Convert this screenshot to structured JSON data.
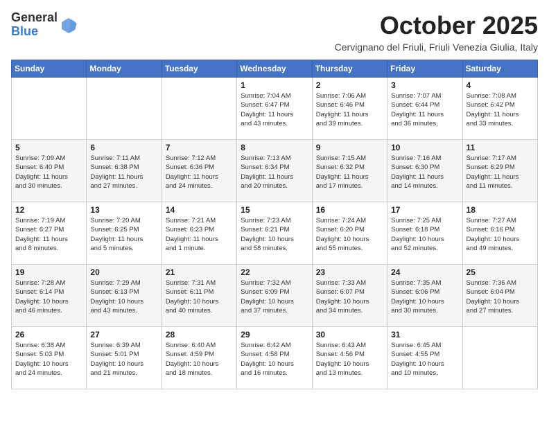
{
  "logo": {
    "general": "General",
    "blue": "Blue"
  },
  "header": {
    "title": "October 2025",
    "subtitle": "Cervignano del Friuli, Friuli Venezia Giulia, Italy"
  },
  "days_of_week": [
    "Sunday",
    "Monday",
    "Tuesday",
    "Wednesday",
    "Thursday",
    "Friday",
    "Saturday"
  ],
  "weeks": [
    [
      {
        "day": "",
        "detail": ""
      },
      {
        "day": "",
        "detail": ""
      },
      {
        "day": "",
        "detail": ""
      },
      {
        "day": "1",
        "detail": "Sunrise: 7:04 AM\nSunset: 6:47 PM\nDaylight: 11 hours\nand 43 minutes."
      },
      {
        "day": "2",
        "detail": "Sunrise: 7:06 AM\nSunset: 6:46 PM\nDaylight: 11 hours\nand 39 minutes."
      },
      {
        "day": "3",
        "detail": "Sunrise: 7:07 AM\nSunset: 6:44 PM\nDaylight: 11 hours\nand 36 minutes."
      },
      {
        "day": "4",
        "detail": "Sunrise: 7:08 AM\nSunset: 6:42 PM\nDaylight: 11 hours\nand 33 minutes."
      }
    ],
    [
      {
        "day": "5",
        "detail": "Sunrise: 7:09 AM\nSunset: 6:40 PM\nDaylight: 11 hours\nand 30 minutes."
      },
      {
        "day": "6",
        "detail": "Sunrise: 7:11 AM\nSunset: 6:38 PM\nDaylight: 11 hours\nand 27 minutes."
      },
      {
        "day": "7",
        "detail": "Sunrise: 7:12 AM\nSunset: 6:36 PM\nDaylight: 11 hours\nand 24 minutes."
      },
      {
        "day": "8",
        "detail": "Sunrise: 7:13 AM\nSunset: 6:34 PM\nDaylight: 11 hours\nand 20 minutes."
      },
      {
        "day": "9",
        "detail": "Sunrise: 7:15 AM\nSunset: 6:32 PM\nDaylight: 11 hours\nand 17 minutes."
      },
      {
        "day": "10",
        "detail": "Sunrise: 7:16 AM\nSunset: 6:30 PM\nDaylight: 11 hours\nand 14 minutes."
      },
      {
        "day": "11",
        "detail": "Sunrise: 7:17 AM\nSunset: 6:29 PM\nDaylight: 11 hours\nand 11 minutes."
      }
    ],
    [
      {
        "day": "12",
        "detail": "Sunrise: 7:19 AM\nSunset: 6:27 PM\nDaylight: 11 hours\nand 8 minutes."
      },
      {
        "day": "13",
        "detail": "Sunrise: 7:20 AM\nSunset: 6:25 PM\nDaylight: 11 hours\nand 5 minutes."
      },
      {
        "day": "14",
        "detail": "Sunrise: 7:21 AM\nSunset: 6:23 PM\nDaylight: 11 hours\nand 1 minute."
      },
      {
        "day": "15",
        "detail": "Sunrise: 7:23 AM\nSunset: 6:21 PM\nDaylight: 10 hours\nand 58 minutes."
      },
      {
        "day": "16",
        "detail": "Sunrise: 7:24 AM\nSunset: 6:20 PM\nDaylight: 10 hours\nand 55 minutes."
      },
      {
        "day": "17",
        "detail": "Sunrise: 7:25 AM\nSunset: 6:18 PM\nDaylight: 10 hours\nand 52 minutes."
      },
      {
        "day": "18",
        "detail": "Sunrise: 7:27 AM\nSunset: 6:16 PM\nDaylight: 10 hours\nand 49 minutes."
      }
    ],
    [
      {
        "day": "19",
        "detail": "Sunrise: 7:28 AM\nSunset: 6:14 PM\nDaylight: 10 hours\nand 46 minutes."
      },
      {
        "day": "20",
        "detail": "Sunrise: 7:29 AM\nSunset: 6:13 PM\nDaylight: 10 hours\nand 43 minutes."
      },
      {
        "day": "21",
        "detail": "Sunrise: 7:31 AM\nSunset: 6:11 PM\nDaylight: 10 hours\nand 40 minutes."
      },
      {
        "day": "22",
        "detail": "Sunrise: 7:32 AM\nSunset: 6:09 PM\nDaylight: 10 hours\nand 37 minutes."
      },
      {
        "day": "23",
        "detail": "Sunrise: 7:33 AM\nSunset: 6:07 PM\nDaylight: 10 hours\nand 34 minutes."
      },
      {
        "day": "24",
        "detail": "Sunrise: 7:35 AM\nSunset: 6:06 PM\nDaylight: 10 hours\nand 30 minutes."
      },
      {
        "day": "25",
        "detail": "Sunrise: 7:36 AM\nSunset: 6:04 PM\nDaylight: 10 hours\nand 27 minutes."
      }
    ],
    [
      {
        "day": "26",
        "detail": "Sunrise: 6:38 AM\nSunset: 5:03 PM\nDaylight: 10 hours\nand 24 minutes."
      },
      {
        "day": "27",
        "detail": "Sunrise: 6:39 AM\nSunset: 5:01 PM\nDaylight: 10 hours\nand 21 minutes."
      },
      {
        "day": "28",
        "detail": "Sunrise: 6:40 AM\nSunset: 4:59 PM\nDaylight: 10 hours\nand 18 minutes."
      },
      {
        "day": "29",
        "detail": "Sunrise: 6:42 AM\nSunset: 4:58 PM\nDaylight: 10 hours\nand 16 minutes."
      },
      {
        "day": "30",
        "detail": "Sunrise: 6:43 AM\nSunset: 4:56 PM\nDaylight: 10 hours\nand 13 minutes."
      },
      {
        "day": "31",
        "detail": "Sunrise: 6:45 AM\nSunset: 4:55 PM\nDaylight: 10 hours\nand 10 minutes."
      },
      {
        "day": "",
        "detail": ""
      }
    ]
  ]
}
